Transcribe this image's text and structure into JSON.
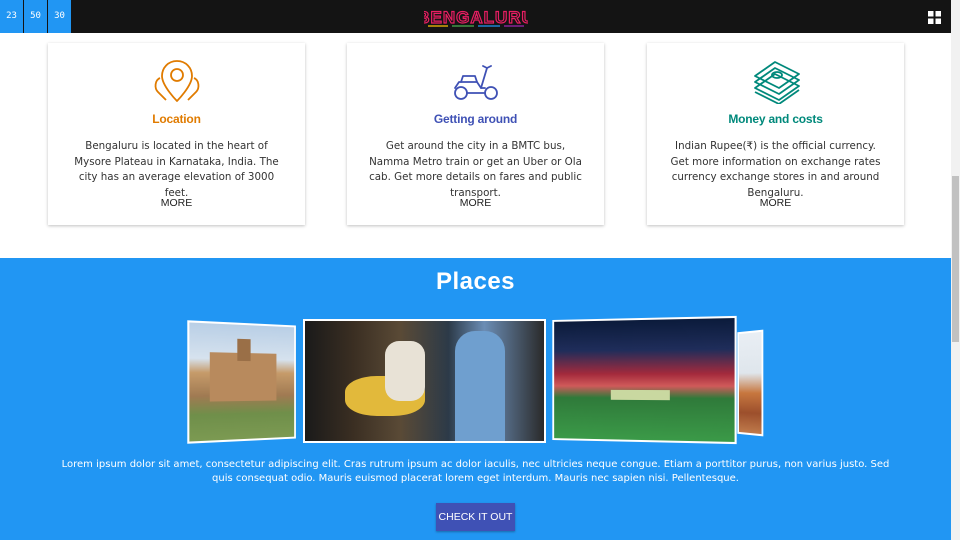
{
  "header": {
    "clock": [
      "23",
      "50",
      "30"
    ],
    "logo_text": "BENGALURU",
    "menu_icon": "grid-icon"
  },
  "cards": [
    {
      "title": "Location",
      "title_color": "#e07b00",
      "icon": "map-pin-icon",
      "text": "Bengaluru is located in the heart of Mysore Plateau in Karnataka, India. The city has an average elevation of 3000 feet.",
      "more": "MORE"
    },
    {
      "title": "Getting around",
      "title_color": "#3f51b5",
      "icon": "scooter-icon",
      "text": "Get around the city in a BMTC bus, Namma Metro train or get an Uber or Ola cab. Get more details on fares and public transport.",
      "more": "MORE"
    },
    {
      "title": "Money and costs",
      "title_color": "#00897b",
      "icon": "money-stack-icon",
      "text": "Indian Rupee(₹) is the official currency. Get more information on exchange rates currency exchange stores in and around Bengaluru.",
      "more": "MORE"
    }
  ],
  "places": {
    "title": "Places",
    "description": "Lorem ipsum dolor sit amet, consectetur adipiscing elit. Cras rutrum ipsum ac dolor iaculis, nec ultricies neque congue. Etiam a porttitor purus, non varius justo. Sed quis consequat odio. Mauris euismod placerat lorem eget interdum. Mauris nec sapien nisi. Pellentesque.",
    "cta": "CHECK IT OUT",
    "background": "#2196f3",
    "button_color": "#3f51b5"
  }
}
